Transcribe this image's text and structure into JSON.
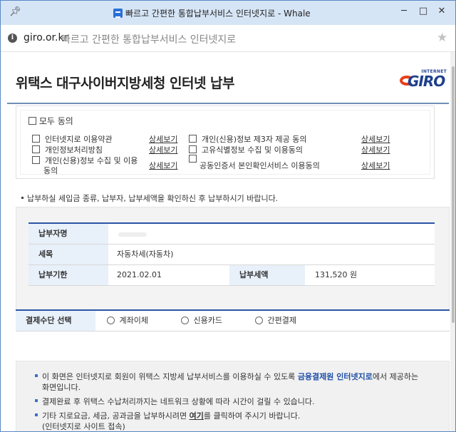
{
  "browser": {
    "window_title": "빠르고 간편한 통합납부서비스 인터넷지로 - Whale",
    "domain": "giro.or.kr",
    "page_title": "빠르고 간편한 통합납부서비스 인터넷지로"
  },
  "header": {
    "title": "위택스 대구사이버지방세청 인터넷 납부",
    "logo_small": "INTERNET",
    "logo_big": "GIRO"
  },
  "agreement": {
    "all_label": "모두 동의",
    "detail_link": "상세보기",
    "left_items": [
      "인터넷지로 이용약관",
      "개인정보처리방침",
      "개인(신용)정보 수집 및 이용",
      "동의"
    ],
    "right_items": [
      "개인(신용)정보 제3자 제공 동의",
      "고유식별정보 수집 및 이용동의",
      "공동인증서 본인확인서비스 이용동의"
    ]
  },
  "notice": "납부하실 세입금 종류, 납부자, 납부세액을 확인하신 후 납부하시기 바랍니다.",
  "payment_info": {
    "payer_label": "납부자명",
    "payer_value": "",
    "tax_label": "세목",
    "tax_value": "자동차세(자동차)",
    "due_label": "납부기한",
    "due_value": "2021.02.01",
    "amount_label": "납부세액",
    "amount_value": "131,520 원"
  },
  "payment_method": {
    "label": "결제수단 선택",
    "options": [
      "계좌이체",
      "신용카드",
      "간편결제"
    ]
  },
  "info_box": {
    "line1_a": "이 화면은 인터넷지로 회원이 위택스 지방세 납부서비스를 이용하실 수 있도록 ",
    "line1_b": "금융결제원 인터넷지로",
    "line1_c": "에서 제공하는",
    "line1_d": "화면입니다.",
    "line2": "결제완료 후 위택스 수납처리까지는 네트워크 상황에 따라 시간이 걸릴 수 있습니다.",
    "line3_a": "기타 지로요금, 세금, 공과금을 납부하시려면 ",
    "line3_b": "여기",
    "line3_c": "를 클릭하여 주시기 바랍니다.",
    "line3_d": "(인터넷지로 사이트 접속)"
  }
}
